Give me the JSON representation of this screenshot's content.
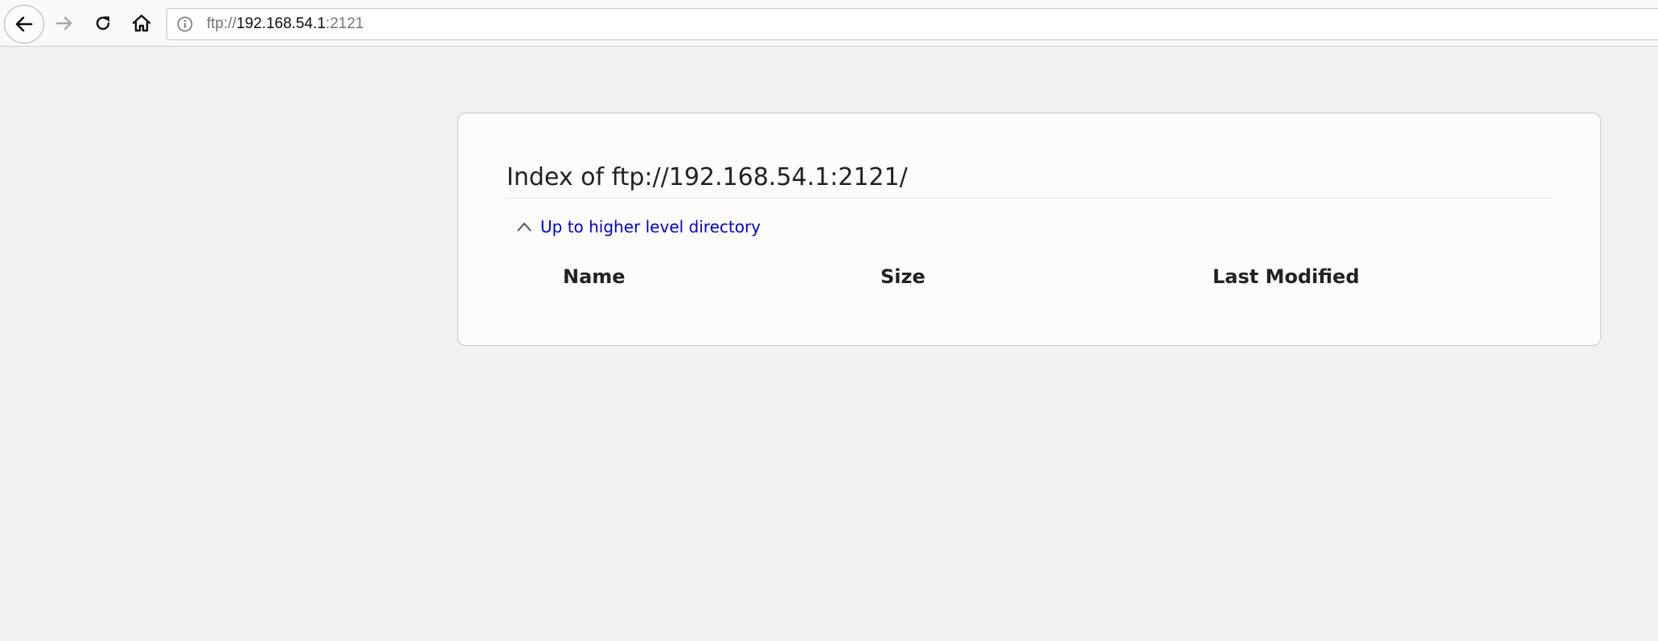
{
  "browser": {
    "icons": {
      "back": "back-arrow-icon",
      "forward": "forward-arrow-icon",
      "reload": "reload-icon",
      "home": "home-icon",
      "site_info": "info-icon"
    },
    "url": {
      "scheme": "ftp://",
      "host": "192.168.54.1",
      "port": ":2121"
    }
  },
  "page": {
    "title": "Index of ftp://192.168.54.1:2121/",
    "up_link": "Up to higher level directory",
    "columns": [
      "Name",
      "Size",
      "Last Modified"
    ],
    "rows": []
  },
  "colors": {
    "page_background": "#f0f0f3",
    "card_background": "#fcfcfc",
    "link": "#0000cc",
    "text": "#222222"
  }
}
